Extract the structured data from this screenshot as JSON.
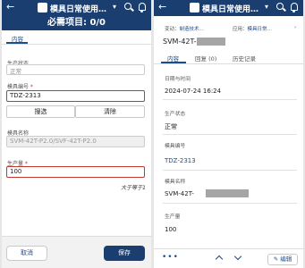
{
  "left": {
    "topbar": {
      "title": "模具日常使用…"
    },
    "banner": "必需项目: 0/0",
    "tab": "内容",
    "status": {
      "label": "生产状态",
      "value": "正常"
    },
    "mold_no": {
      "label": "模具编号",
      "value": "TDZ-2313"
    },
    "search_btn": "搜选",
    "clear_btn": "清除",
    "mold_name": {
      "label": "模具名称",
      "value": "SVM-42T-P2.0/SVF-42T-P2.0"
    },
    "quantity": {
      "label": "生产量",
      "value": "100",
      "hint": "大于等于1"
    },
    "cancel_btn": "取消",
    "save_btn": "保存"
  },
  "right": {
    "topbar": {
      "title": "模具日常使用…"
    },
    "breadcrumb": {
      "prefix1": "变动：",
      "link1": "制造技术…",
      "prefix2": "应用：",
      "link2": "模具日常…"
    },
    "record_title": "SVM-42T-",
    "tabs": [
      "内容",
      "回复 (0)",
      "历史记录"
    ],
    "fields": [
      {
        "label": "日期与时间",
        "value": "2024-07-24 16:24"
      },
      {
        "label": "生产状态",
        "value": "正常"
      },
      {
        "label": "模具编号",
        "value": "TDZ-2313"
      },
      {
        "label": "模具名称",
        "value": "SVM-42T-"
      },
      {
        "label": "生产量",
        "value": "100"
      }
    ],
    "more": "•••",
    "edit_btn": "编辑"
  },
  "colors": {
    "primary": "#1b3e70",
    "link": "#1d4e89",
    "required": "#c23934"
  }
}
